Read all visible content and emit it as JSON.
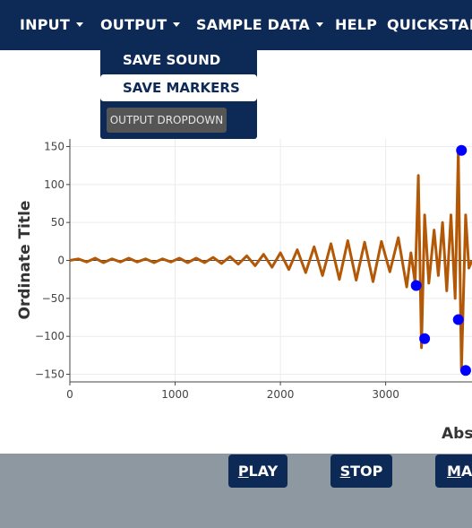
{
  "nav": {
    "items": [
      {
        "label": "INPUT",
        "caret": true
      },
      {
        "label": "OUTPUT",
        "caret": true
      },
      {
        "label": "SAMPLE DATA",
        "caret": true
      },
      {
        "label": "HELP",
        "caret": false
      },
      {
        "label": "QUICKSTART",
        "caret": false
      }
    ]
  },
  "output_menu": {
    "items": [
      "SAVE SOUND",
      "SAVE MARKERS"
    ],
    "active": "SAVE MARKERS",
    "select_label": "OUTPUT DROPDOWN"
  },
  "buttons": {
    "play": {
      "first": "P",
      "rest": "LAY"
    },
    "stop": {
      "first": "S",
      "rest": "TOP"
    },
    "third": {
      "first": "M",
      "rest": "A"
    }
  },
  "colors": {
    "navbar": "#0d2a57",
    "line": "#b35806",
    "markers": "#0000ff",
    "footer": "#8d98a1"
  },
  "chart_data": {
    "type": "line",
    "ylabel": "Ordinate Title",
    "xlabel": "Abs",
    "xlim": [
      0,
      3820
    ],
    "ylim": [
      -160,
      160
    ],
    "xticks": [
      0,
      1000,
      2000,
      3000
    ],
    "yticks": [
      150,
      100,
      50,
      0,
      -50,
      -100,
      -150
    ],
    "grid": true,
    "series": [
      {
        "x": [
          0,
          80,
          160,
          240,
          320,
          400,
          480,
          560,
          640,
          720,
          800,
          880,
          960,
          1040,
          1120,
          1200,
          1280,
          1360,
          1440,
          1520,
          1600,
          1680,
          1760,
          1840,
          1920,
          2000,
          2080,
          2160,
          2240,
          2320,
          2400,
          2480,
          2560,
          2640,
          2720,
          2800,
          2880,
          2960,
          3040,
          3120,
          3200,
          3240,
          3280,
          3310,
          3340,
          3370,
          3410,
          3460,
          3500,
          3540,
          3580,
          3620,
          3660,
          3690,
          3720,
          3760,
          3790,
          3820
        ],
        "y": [
          0,
          2,
          -2,
          3,
          -3,
          2,
          -2,
          3,
          -2,
          2,
          -3,
          2,
          -2,
          3,
          -3,
          3,
          -3,
          4,
          -4,
          5,
          -5,
          6,
          -7,
          8,
          -9,
          10,
          -12,
          14,
          -16,
          18,
          -20,
          22,
          -25,
          26,
          -26,
          24,
          -28,
          25,
          -15,
          30,
          -35,
          10,
          -30,
          112,
          -115,
          60,
          -30,
          40,
          -20,
          50,
          -40,
          60,
          -50,
          145,
          -145,
          60,
          -10,
          0
        ]
      }
    ],
    "markers": [
      {
        "x": 3290,
        "y": -33
      },
      {
        "x": 3370,
        "y": -103
      },
      {
        "x": 3690,
        "y": -78
      },
      {
        "x": 3720,
        "y": 145
      },
      {
        "x": 3760,
        "y": -145
      }
    ]
  }
}
